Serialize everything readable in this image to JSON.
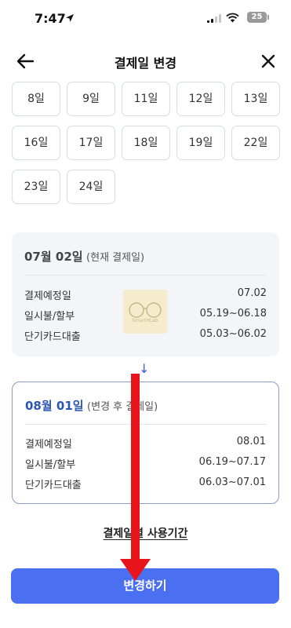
{
  "status_bar": {
    "time": "7:47",
    "battery": "25"
  },
  "header": {
    "title": "결제일 변경"
  },
  "days": [
    "8일",
    "9일",
    "11일",
    "12일",
    "13일",
    "16일",
    "17일",
    "18일",
    "19일",
    "22일",
    "23일",
    "24일"
  ],
  "current": {
    "date": "07월 02일",
    "note": "(현재 결제일)",
    "rows": [
      {
        "label": "결제예정일",
        "value": "07.02"
      },
      {
        "label": "일시불/할부",
        "value": "05.19~06.18"
      },
      {
        "label": "단기카드대출",
        "value": "05.03~06.02"
      }
    ]
  },
  "watermark": {
    "text": "SmartHLab"
  },
  "arrow_symbol": "↓",
  "after": {
    "date": "08월 01일",
    "note": "(변경 후 결제일)",
    "rows": [
      {
        "label": "결제예정일",
        "value": "08.01"
      },
      {
        "label": "일시불/할부",
        "value": "06.19~07.17"
      },
      {
        "label": "단기카드대출",
        "value": "06.03~07.01"
      }
    ]
  },
  "link_text": "결제일별 사용기간",
  "cta_label": "변경하기",
  "colors": {
    "accent": "#4a6ff0",
    "annotation": "#e8141b",
    "card_border": "#8a9bc6",
    "highlight_date": "#2b56b4"
  }
}
